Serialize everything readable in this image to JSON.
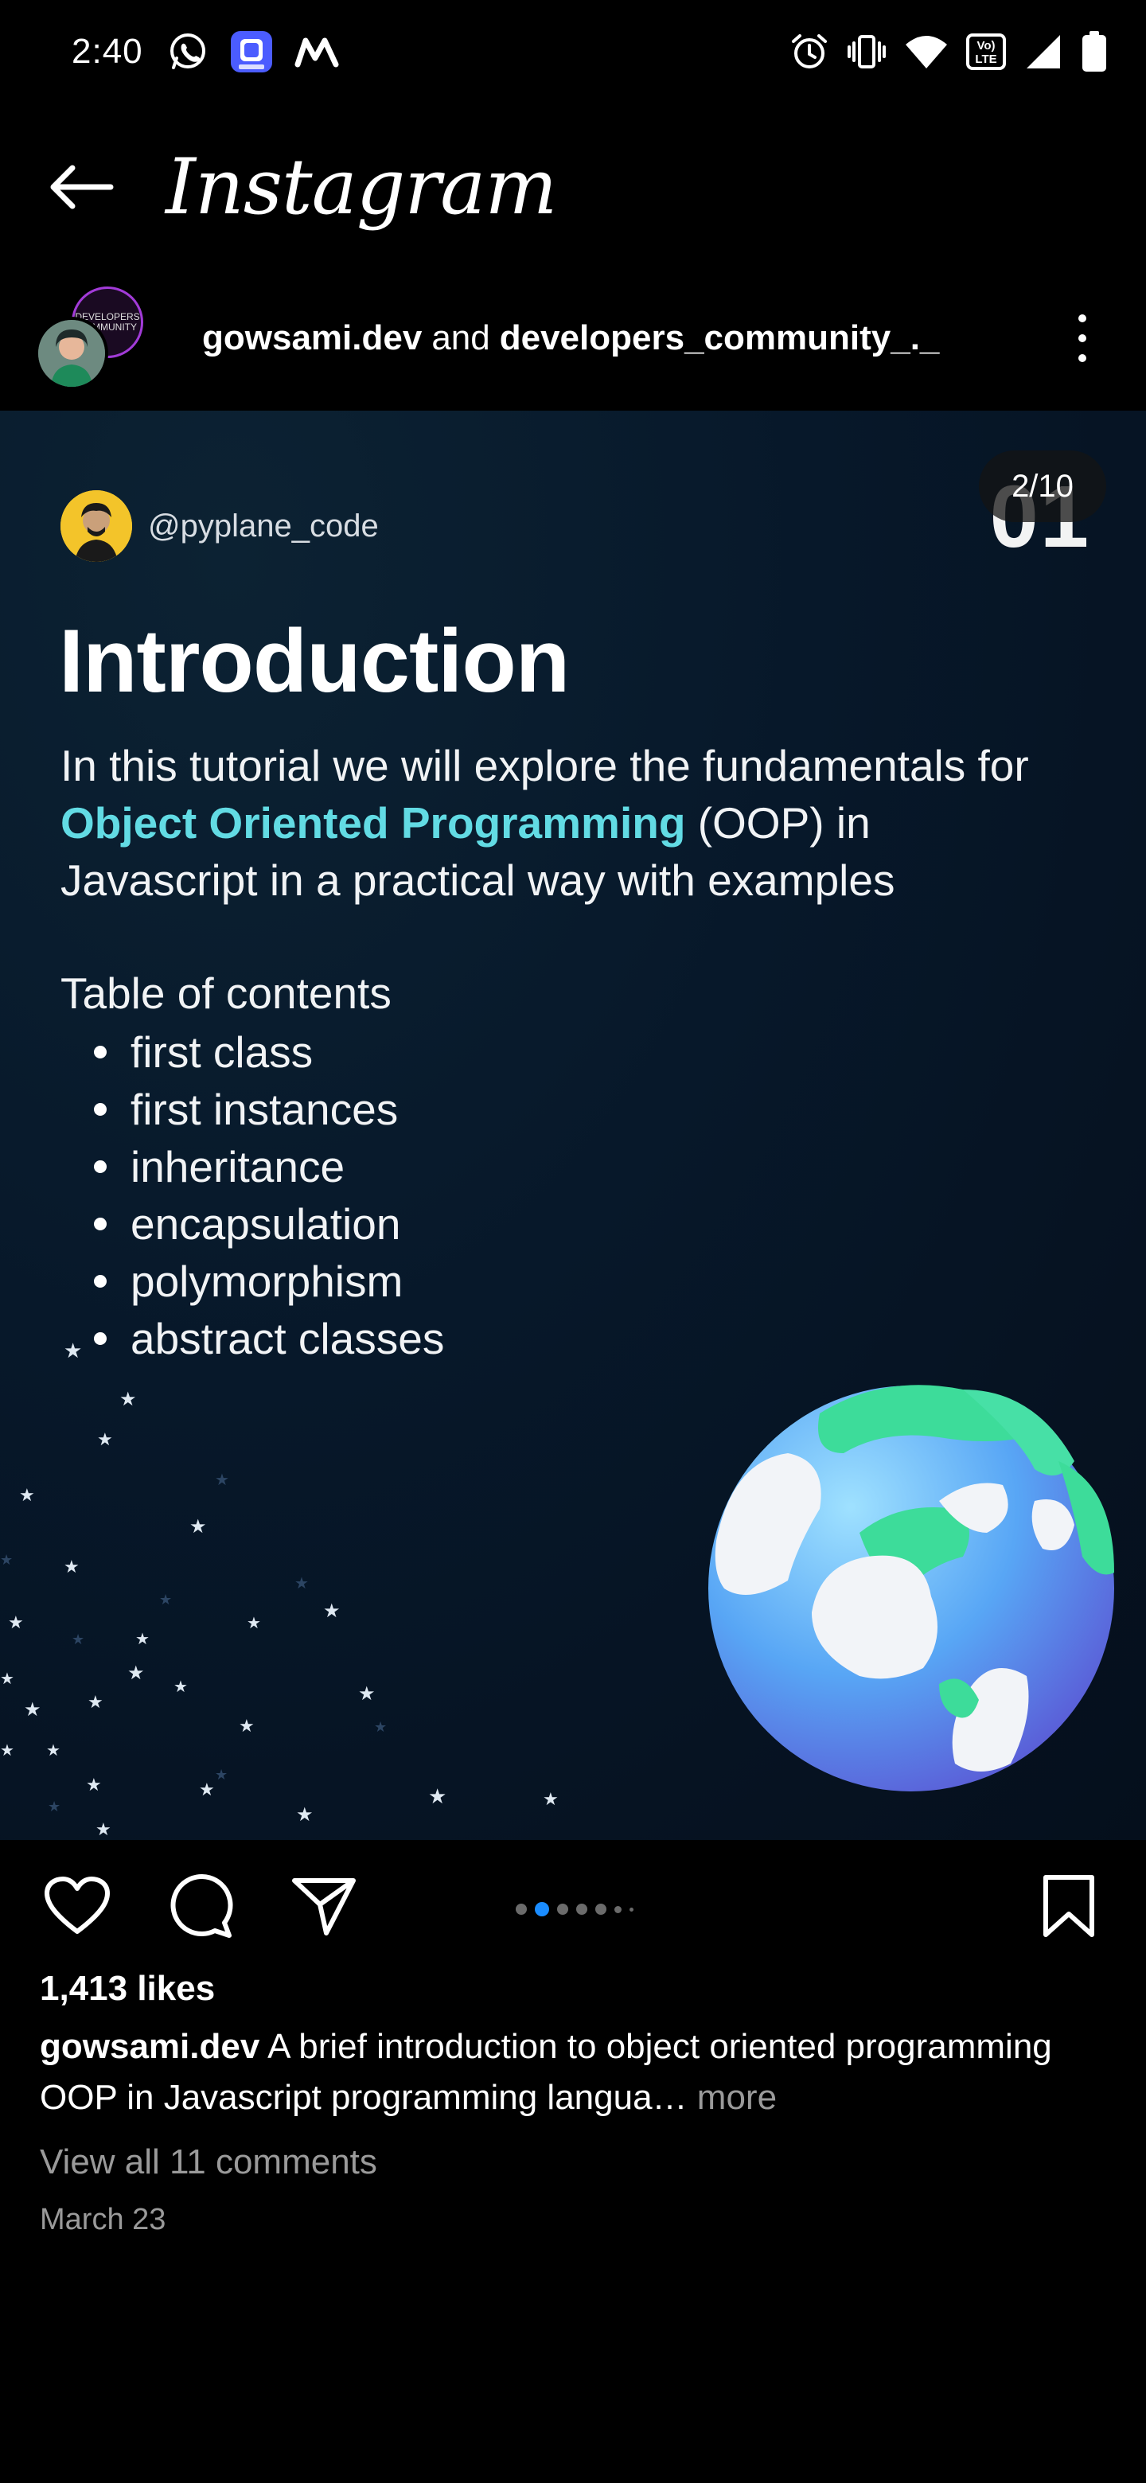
{
  "status_bar": {
    "time": "2:40",
    "left_icons": [
      "whatsapp-icon",
      "app-badge-icon",
      "maps-m-icon"
    ],
    "right_icons": [
      "alarm-icon",
      "vibrate-icon",
      "wifi-icon",
      "volte-icon",
      "signal-icon",
      "battery-icon"
    ],
    "volte_text": "Vo) LTE"
  },
  "header": {
    "brand": "Instagram"
  },
  "post": {
    "author_primary": "gowsami.dev",
    "joiner": "and",
    "author_secondary": "developers_community_._",
    "collab_avatar_text": "DEVELOPERS COMMUNITY"
  },
  "slide": {
    "counter": "2/10",
    "number": "01",
    "handle": "@pyplane_code",
    "title": "Introduction",
    "intro_before": "In this tutorial we will explore the fundamentals for ",
    "intro_highlight": "Object Oriented Programming",
    "intro_after": " (OOP) in Javascript in a practical way with examples",
    "toc_heading": "Table of contents",
    "toc_items": [
      "first class",
      "first instances",
      "inheritance",
      "encapsulation",
      "polymorphism",
      "abstract classes"
    ]
  },
  "carousel": {
    "total": 10,
    "current": 2
  },
  "engagement": {
    "likes": "1,413 likes",
    "caption_user": "gowsami.dev",
    "caption_text": " A brief introduction to object oriented programming OOP in Javascript programming langua…",
    "caption_more": " more",
    "view_comments": "View all 11 comments",
    "date": "March 23"
  },
  "colors": {
    "background": "#000000",
    "slide_bg": "#07182a",
    "highlight": "#62dbe4",
    "active_dot": "#1a8cff",
    "muted_text": "#9a9a9a"
  }
}
